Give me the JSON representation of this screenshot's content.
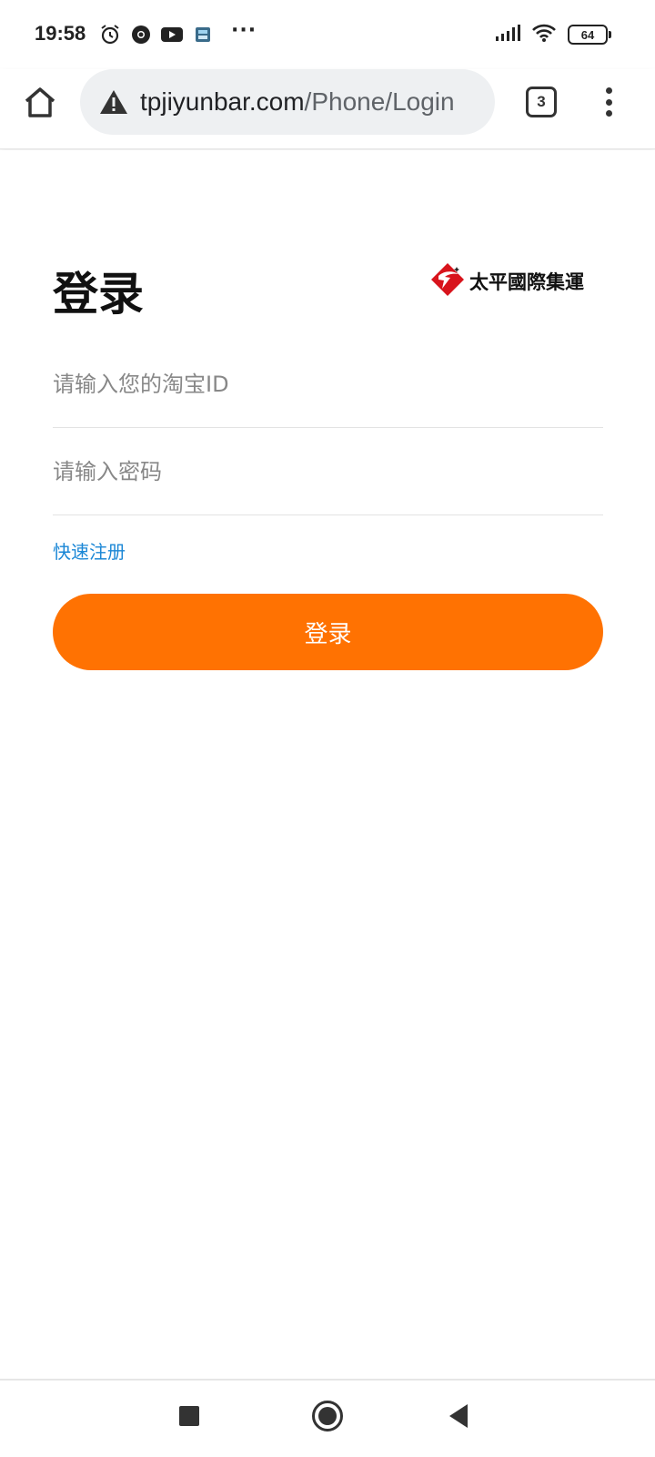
{
  "status_bar": {
    "time": "19:58",
    "battery": "64",
    "icons_left": [
      "alarm-icon",
      "chrome-icon",
      "youtube-icon",
      "app-icon"
    ],
    "icons_right": [
      "signal-icon",
      "wifi-icon",
      "battery-icon"
    ]
  },
  "browser": {
    "url_host": "tpjiyunbar.com",
    "url_path": "/Phone/Login",
    "tab_count": "3"
  },
  "login": {
    "title": "登录",
    "brand_name": "太平國際集運",
    "username_placeholder": "请输入您的淘宝ID",
    "password_placeholder": "请输入密码",
    "register_link": "快速注册",
    "submit_label": "登录"
  },
  "colors": {
    "accent": "#ff7202",
    "link": "#1b87d6"
  }
}
